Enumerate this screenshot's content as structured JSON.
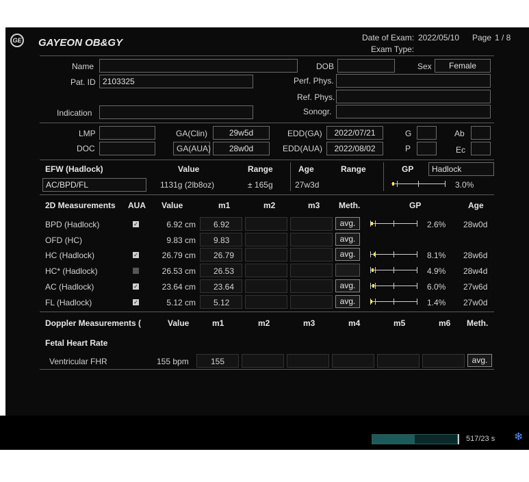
{
  "header": {
    "logo": "GE",
    "facility": "GAYEON OB&GY",
    "date_label": "Date of Exam:",
    "date_value": "2022/05/10",
    "page_label": "Page",
    "page_value": "1 / 8",
    "exam_type_label": "Exam Type:"
  },
  "patient": {
    "name_label": "Name",
    "name_value": "",
    "dob_label": "DOB",
    "dob_value": "",
    "sex_label": "Sex",
    "sex_value": "Female",
    "patid_label": "Pat. ID",
    "patid_value": "2103325",
    "perf_label": "Perf. Phys.",
    "ref_label": "Ref. Phys.",
    "indication_label": "Indication",
    "sonogr_label": "Sonogr."
  },
  "dates": {
    "lmp_label": "LMP",
    "doc_label": "DOC",
    "ga_clin_label": "GA(Clin)",
    "ga_clin_value": "29w5d",
    "ga_aua_label": "GA(AUA)",
    "ga_aua_value": "28w0d",
    "edd_ga_label": "EDD(GA)",
    "edd_ga_value": "2022/07/21",
    "edd_aua_label": "EDD(AUA)",
    "edd_aua_value": "2022/08/02",
    "g_label": "G",
    "p_label": "P",
    "ab_label": "Ab",
    "ec_label": "Ec"
  },
  "efw": {
    "title": "EFW (Hadlock)",
    "value_h": "Value",
    "range_h": "Range",
    "age_h": "Age",
    "range2_h": "Range",
    "gp_h": "GP",
    "method": "Hadlock",
    "formula": "AC/BPD/FL",
    "value": "1131g (2lb8oz)",
    "range": "± 165g",
    "age": "27w3d",
    "gp": "3.0%",
    "gp_frac": 0.03
  },
  "m2d": {
    "title": "2D Measurements",
    "aua_h": "AUA",
    "value_h": "Value",
    "m1_h": "m1",
    "m2_h": "m2",
    "m3_h": "m3",
    "meth_h": "Meth.",
    "gp_h": "GP",
    "age_h": "Age",
    "rows": [
      {
        "label": "BPD (Hadlock)",
        "aua": true,
        "value": "6.92 cm",
        "m1": "6.92",
        "meth": "avg.",
        "gp": "2.6%",
        "gp_frac": 0.026,
        "age": "28w0d"
      },
      {
        "label": "OFD (HC)",
        "aua": null,
        "value": "9.83 cm",
        "m1": "9.83",
        "meth": "avg.",
        "gp": "",
        "gp_frac": null,
        "age": ""
      },
      {
        "label": "HC (Hadlock)",
        "aua": true,
        "value": "26.79 cm",
        "m1": "26.79",
        "meth": "avg.",
        "gp": "8.1%",
        "gp_frac": 0.081,
        "age": "28w6d"
      },
      {
        "label": "HC* (Hadlock)",
        "aua": false,
        "value": "26.53 cm",
        "m1": "26.53",
        "meth": "",
        "gp": "4.9%",
        "gp_frac": 0.049,
        "age": "28w4d"
      },
      {
        "label": "AC (Hadlock)",
        "aua": true,
        "value": "23.64 cm",
        "m1": "23.64",
        "meth": "avg.",
        "gp": "6.0%",
        "gp_frac": 0.06,
        "age": "27w6d"
      },
      {
        "label": "FL (Hadlock)",
        "aua": true,
        "value": "5.12 cm",
        "m1": "5.12",
        "meth": "avg.",
        "gp": "1.4%",
        "gp_frac": 0.014,
        "age": "27w0d"
      }
    ]
  },
  "doppler": {
    "title": "Doppler Measurements (",
    "value_h": "Value",
    "m1_h": "m1",
    "m2_h": "m2",
    "m3_h": "m3",
    "m4_h": "m4",
    "m5_h": "m5",
    "m6_h": "m6",
    "meth_h": "Meth.",
    "section": "Fetal Heart Rate",
    "row_label": "Ventricular FHR",
    "row_value": "155  bpm",
    "row_m1": "155",
    "row_meth": "avg."
  },
  "status": {
    "progress_frac": 0.5,
    "counter": "517/23 s",
    "icon": "snowflake-icon"
  }
}
